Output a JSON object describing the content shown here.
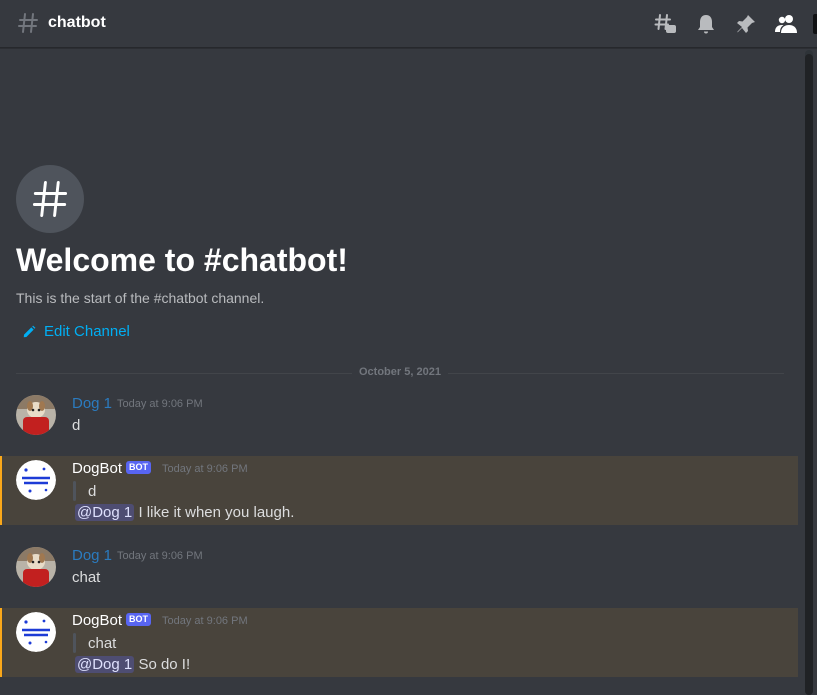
{
  "header": {
    "channel_name": "chatbot",
    "icons": [
      "hash-icon",
      "threads-icon",
      "bell-icon",
      "pin-icon",
      "members-icon"
    ]
  },
  "welcome": {
    "icon": "hash-icon",
    "title": "Welcome to #chatbot!",
    "subtitle": "This is the start of the #chatbot channel.",
    "edit_label": "Edit Channel",
    "edit_icon": "pencil-icon"
  },
  "divider": {
    "date": "October 5, 2021"
  },
  "messages": [
    {
      "author": "Dog 1",
      "time": "Today at 9:06 PM",
      "text": "d"
    },
    {
      "author": "DogBot",
      "tag": "BOT",
      "time": "Today at 9:06 PM",
      "quote": "d",
      "mention": "@Dog 1",
      "text": "I like it when you laugh."
    },
    {
      "author": "Dog 1",
      "time": "Today at 9:06 PM",
      "text": "chat"
    },
    {
      "author": "DogBot",
      "tag": "BOT",
      "time": "Today at 9:06 PM",
      "quote": "chat",
      "mention": "@Dog 1",
      "text": "So do I!"
    }
  ],
  "colors": {
    "background": "#36393f",
    "accent_link": "#00aff4",
    "mention_highlight": "#49443c",
    "mention_bar": "#faa81a",
    "bot_tag": "#5865f2"
  }
}
